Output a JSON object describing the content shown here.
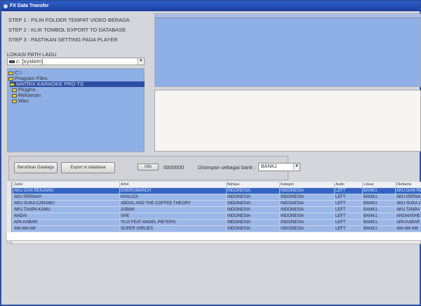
{
  "window": {
    "title": "FX Data Transfer"
  },
  "steps": [
    "STEP 1 : PILIH FOLDER TEMPAT VIDEO BERADA",
    "STEP 2 : KLIK TOMBOL EXPORT TO DATABASE",
    "STEP 3 : PASTIKAN SETTING PADA PLAYER"
  ],
  "path_label": "LOKASI PATH LAGU",
  "drive": "c: [system]",
  "tree": [
    "C:\\",
    "Program Files",
    "MATRIX KARAOKE PRO TS",
    "Plugins",
    "Rekaman",
    "Wav"
  ],
  "toolbar": {
    "clear": "Bersihkan Datalagu",
    "export": "Export to database",
    "info": "Info",
    "counter": "0000000",
    "bank_label": "Disimpan sebagai bank :",
    "bank": "BANK1"
  },
  "grid": {
    "columns": [
      "Judul",
      "Artist",
      "Bahasa",
      "Kategori",
      "Audio",
      "Lokasi",
      "FileName"
    ],
    "rows": [
      [
        "AKU DAN RENJANA",
        "ENDRUMARCH",
        "INDONESIA",
        "INDONESIA",
        "LEFT",
        "BANK1",
        "AKU DAN RE"
      ],
      [
        "AKU PERNAH",
        "KHALIZA",
        "INDONESIA",
        "INDONESIA",
        "LEFT",
        "BANK1",
        "AKU PERNAH"
      ],
      [
        "AKU SUKA CARAMU",
        "ABDUL AND THE COFFEE THEORY",
        "INDONESIA",
        "INDONESIA",
        "LEFT",
        "BANK1",
        "AKU SUKA C"
      ],
      [
        "AKU TANPA KAMU",
        "ASBAK",
        "INDONESIA",
        "INDONESIA",
        "LEFT",
        "BANK1",
        "AKU TANPA"
      ],
      [
        "ANDAI",
        "SHE",
        "INDONESIA",
        "INDONESIA",
        "LEFT",
        "BANK1",
        "ANDAI#SHE"
      ],
      [
        "APA KABAR",
        "YUJI FEAT ANGEL PIETERS",
        "INDONESIA",
        "INDONESIA",
        "LEFT",
        "BANK1",
        "APA KABAR"
      ],
      [
        "AW AW AW",
        "SUPER GIRLIES",
        "INDONESIA",
        "INDONESIA",
        "LEFT",
        "BANK1",
        "AW AW AW"
      ]
    ]
  }
}
